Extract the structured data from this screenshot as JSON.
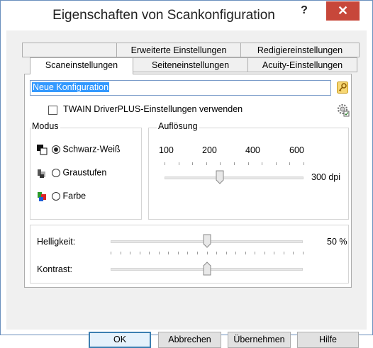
{
  "window": {
    "title": "Eigenschaften von Scankonfiguration",
    "help_label": "?",
    "close_label": "✕"
  },
  "tabs_back": [
    "Erweiterte Einstellungen",
    "Redigiereinstellungen"
  ],
  "tabs_front": [
    "Scaneinstellungen",
    "Seiteneinstellungen",
    "Acuity-Einstellungen"
  ],
  "active_tab": "Scaneinstellungen",
  "config_name": "Neue Konfiguration",
  "twain_checkbox": {
    "label": "TWAIN DriverPLUS-Einstellungen verwenden",
    "checked": false
  },
  "mode": {
    "title": "Modus",
    "options": [
      "Schwarz-Weiß",
      "Graustufen",
      "Farbe"
    ],
    "selected": "Schwarz-Weiß"
  },
  "resolution": {
    "title": "Auflösung",
    "scale_labels": [
      "100",
      "200",
      "400",
      "600"
    ],
    "value_label": "300 dpi",
    "value_dpi": 300
  },
  "brightness": {
    "label": "Helligkeit:",
    "value_label": "50 %",
    "value_percent": 50
  },
  "contrast": {
    "label": "Kontrast:",
    "value_percent": 50
  },
  "buttons": {
    "ok": "OK",
    "cancel": "Abbrechen",
    "apply": "Übernehmen",
    "help": "Hilfe"
  },
  "colors": {
    "accent": "#3399ff",
    "close": "#c7473a",
    "dialog_bg": "#f0f0f0"
  }
}
